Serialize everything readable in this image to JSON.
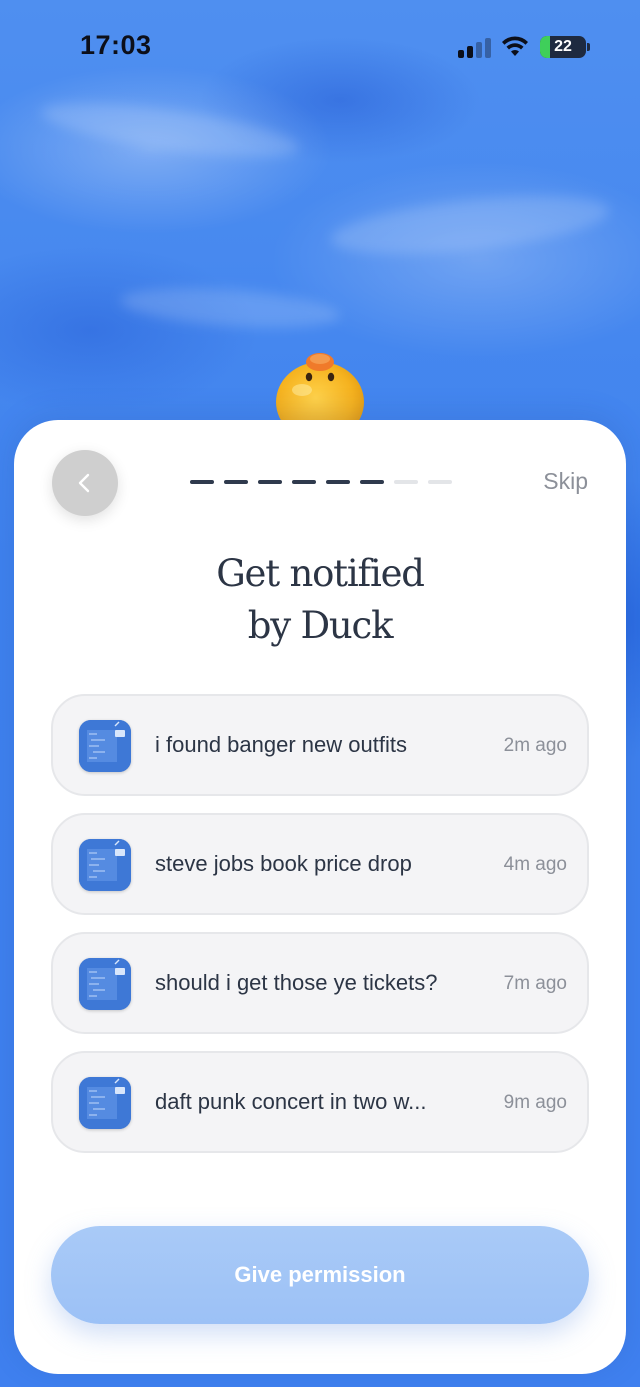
{
  "status_bar": {
    "time": "17:03",
    "battery_level": "22",
    "battery_charging": true
  },
  "onboarding": {
    "back_icon": "chevron-left-icon",
    "progress": {
      "total_steps": 8,
      "completed_steps": 6
    },
    "skip_label": "Skip",
    "title_line1": "Get notified",
    "title_line2": "by Duck",
    "notifications": [
      {
        "text": "i found banger new outfits",
        "time": "2m ago",
        "icon": "app-icon"
      },
      {
        "text": "steve jobs book price drop",
        "time": "4m ago",
        "icon": "app-icon"
      },
      {
        "text": "should i get those ye tickets?",
        "time": "7m ago",
        "icon": "app-icon"
      },
      {
        "text": "daft punk concert in two w...",
        "time": "9m ago",
        "icon": "app-icon"
      }
    ],
    "permission_button_label": "Give permission"
  },
  "colors": {
    "background": "#3f82ee",
    "card": "#ffffff",
    "accent_button": "#a9caf7",
    "title_text": "#2c3545"
  }
}
